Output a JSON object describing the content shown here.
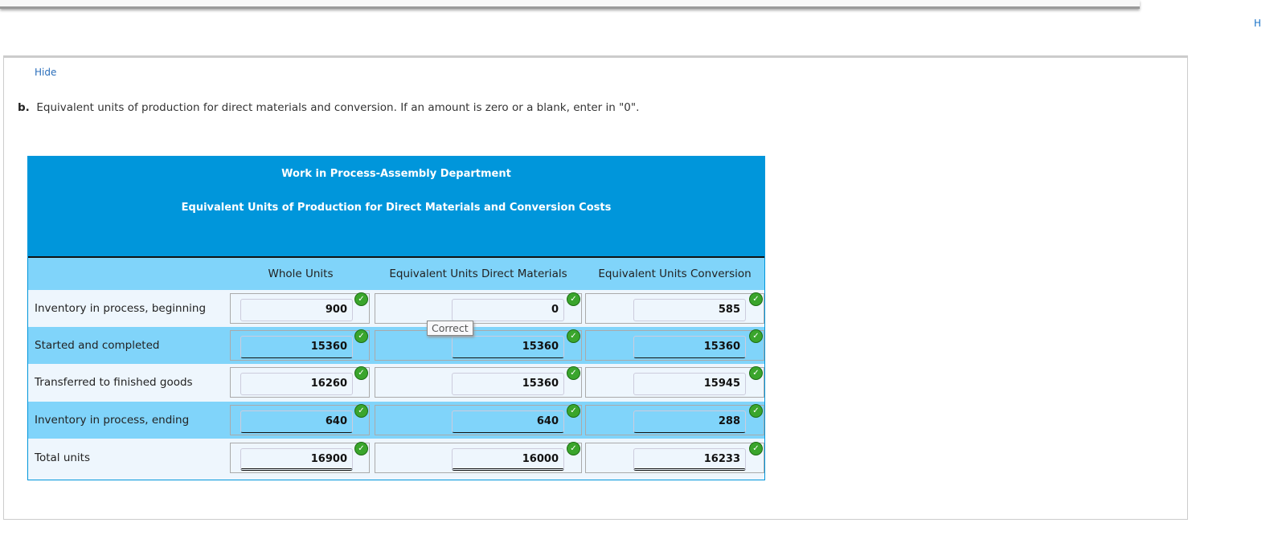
{
  "edge_link": "H",
  "hide_link": "Hide",
  "question": {
    "prefix": "b.",
    "text": "Equivalent units of production for direct materials and conversion. If an amount is zero or a blank, enter in \"0\"."
  },
  "table": {
    "title": "Work in Process-Assembly Department",
    "subtitle": "Equivalent Units of Production for Direct Materials and Conversion Costs",
    "columns": [
      "Whole Units",
      "Equivalent Units Direct Materials",
      "Equivalent Units Conversion"
    ],
    "rows": [
      {
        "label": "Inventory in process, beginning",
        "values": [
          "900",
          "0",
          "585"
        ]
      },
      {
        "label": "Started and completed",
        "values": [
          "15360",
          "15360",
          "15360"
        ]
      },
      {
        "label": "Transferred to finished goods",
        "values": [
          "16260",
          "15360",
          "15945"
        ]
      },
      {
        "label": "Inventory in process, ending",
        "values": [
          "640",
          "640",
          "288"
        ]
      },
      {
        "label": "Total units",
        "values": [
          "16900",
          "16000",
          "16233"
        ]
      }
    ]
  },
  "tooltip": "Correct",
  "check_mark": "✓"
}
